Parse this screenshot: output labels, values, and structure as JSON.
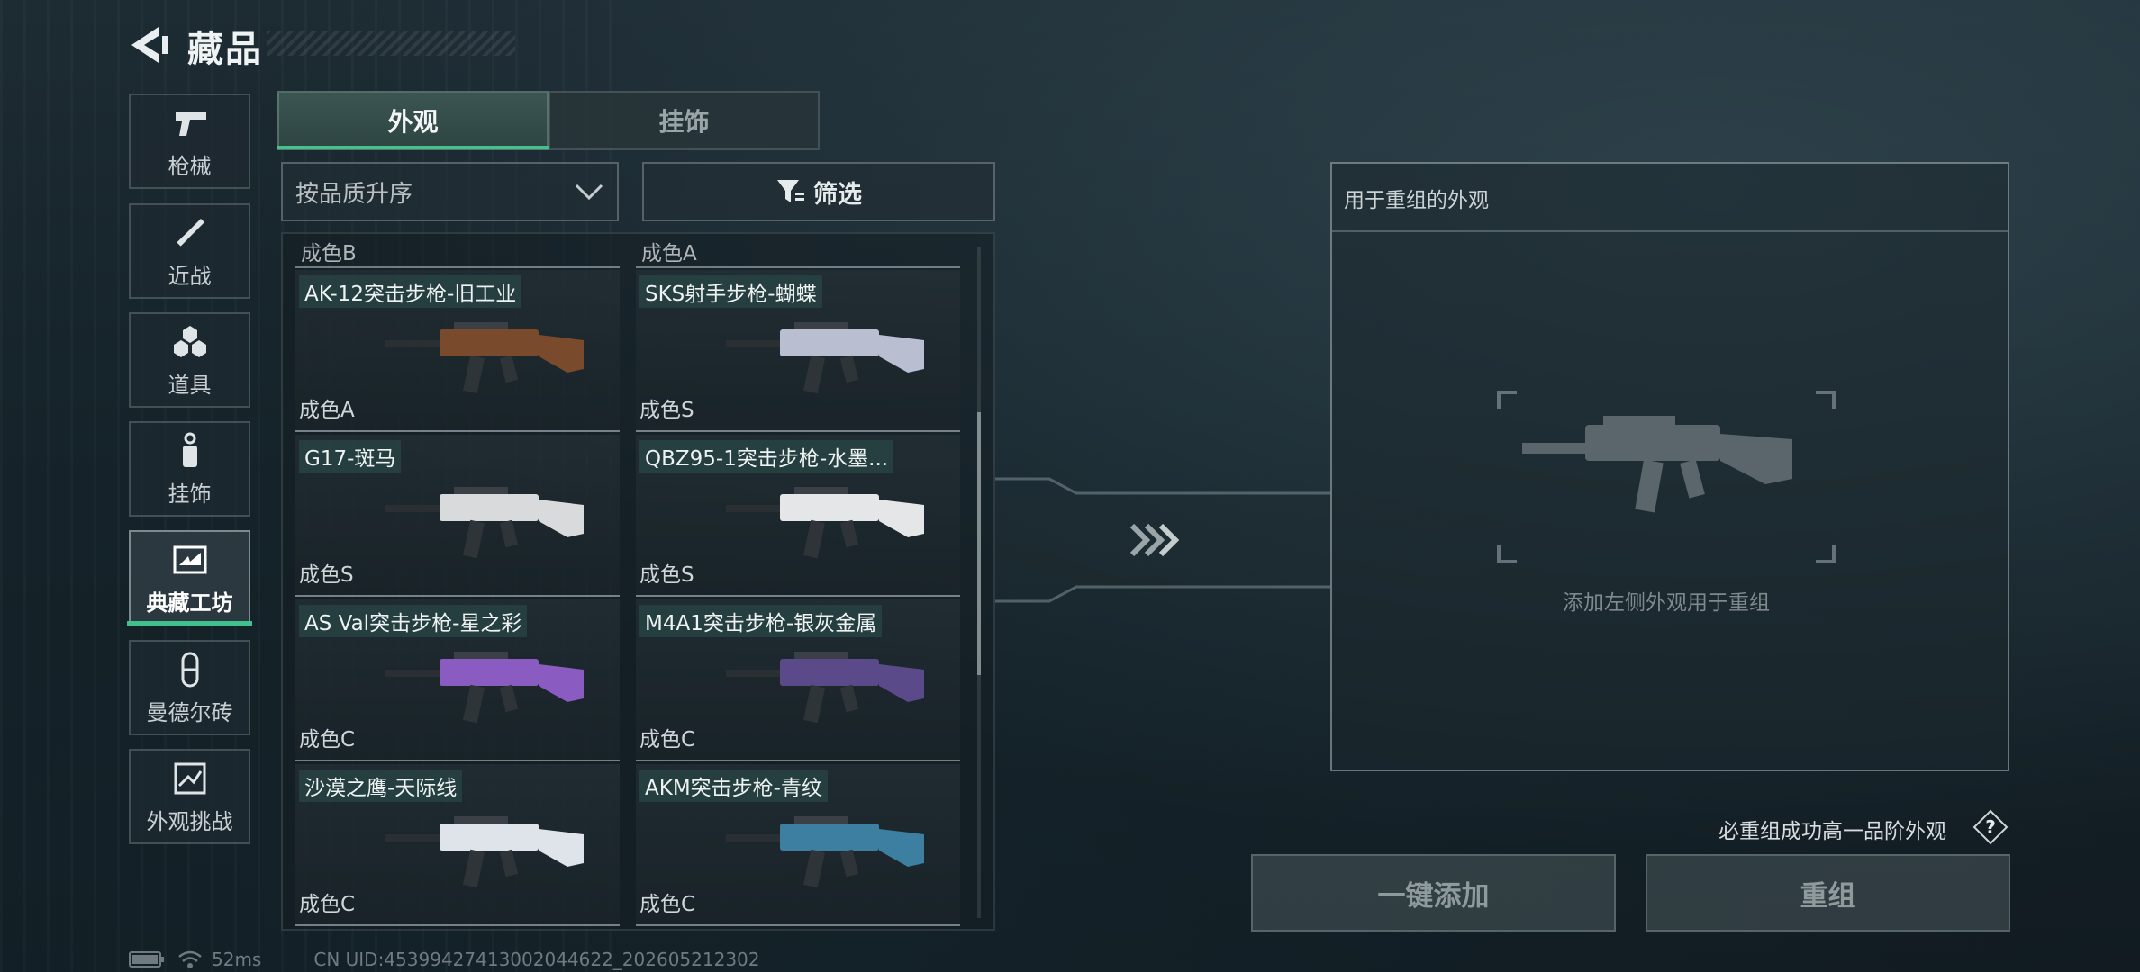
{
  "header": {
    "title": "藏品"
  },
  "sidebar": {
    "items": [
      {
        "label": "枪械",
        "icon": "pistol-icon"
      },
      {
        "label": "近战",
        "icon": "knife-icon"
      },
      {
        "label": "道具",
        "icon": "grenade-icon"
      },
      {
        "label": "挂饰",
        "icon": "charm-icon"
      },
      {
        "label": "典藏工坊",
        "icon": "workshop-icon",
        "active": true
      },
      {
        "label": "曼德尔砖",
        "icon": "mandel-brick-icon"
      },
      {
        "label": "外观挑战",
        "icon": "challenge-icon"
      }
    ]
  },
  "tabs": [
    {
      "label": "外观",
      "active": true
    },
    {
      "label": "挂饰",
      "active": false
    }
  ],
  "sort": {
    "value": "按品质升序"
  },
  "filter": {
    "label": "筛选"
  },
  "list": {
    "partial_top": [
      "成色B",
      "成色A"
    ],
    "items": [
      {
        "name": "AK-12突击步枪-旧工业",
        "grade": "成色A",
        "skin_color": "#7a4a2c"
      },
      {
        "name": "SKS射手步枪-蝴蝶",
        "grade": "成色S",
        "skin_color": "#b9bfd0"
      },
      {
        "name": "G17-斑马",
        "grade": "成色S",
        "skin_color": "#d9dadb"
      },
      {
        "name": "QBZ95-1突击步枪-水墨...",
        "grade": "成色S",
        "skin_color": "#e4e6e8"
      },
      {
        "name": "AS Val突击步枪-星之彩",
        "grade": "成色C",
        "skin_color": "#8a5cc2"
      },
      {
        "name": "M4A1突击步枪-银灰金属",
        "grade": "成色C",
        "skin_color": "#5b4a8a"
      },
      {
        "name": "沙漠之鹰-天际线",
        "grade": "成色C",
        "skin_color": "#dfe3ea"
      },
      {
        "name": "AKM突击步枪-青纹",
        "grade": "成色C",
        "skin_color": "#3d7fa0"
      }
    ]
  },
  "recompose": {
    "title": "用于重组的外观",
    "placeholder": "添加左侧外观用于重组",
    "hint": "必重组成功高一品阶外观",
    "add_all_label": "一键添加",
    "recompose_label": "重组"
  },
  "status": {
    "ping": "52ms",
    "uid": "CN UID:4539942741300204462​2_202605212302"
  }
}
